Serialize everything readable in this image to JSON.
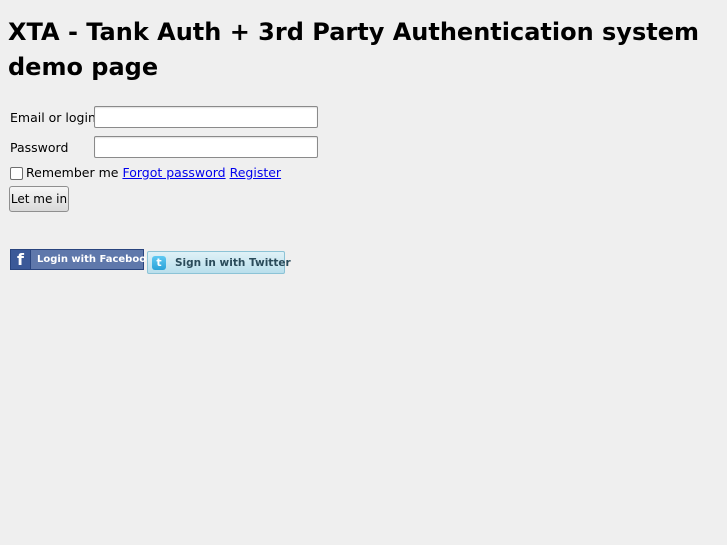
{
  "page": {
    "title": "XTA - Tank Auth + 3rd Party Authentication system demo page"
  },
  "login_form": {
    "login_label": "Email or login",
    "login_value": "",
    "password_label": "Password",
    "password_value": "",
    "remember_label": "Remember me",
    "remember_checked": false,
    "forgot_link": "Forgot password",
    "register_link": "Register",
    "submit_label": "Let me in"
  },
  "social": {
    "facebook_label": "Login with Facebook",
    "facebook_icon": "facebook-f-icon",
    "twitter_label": "Sign in with Twitter",
    "twitter_icon": "twitter-t-icon",
    "colors": {
      "facebook": "#5f78ab",
      "twitter": "#c6e6f1",
      "link": "#0000ee"
    }
  }
}
